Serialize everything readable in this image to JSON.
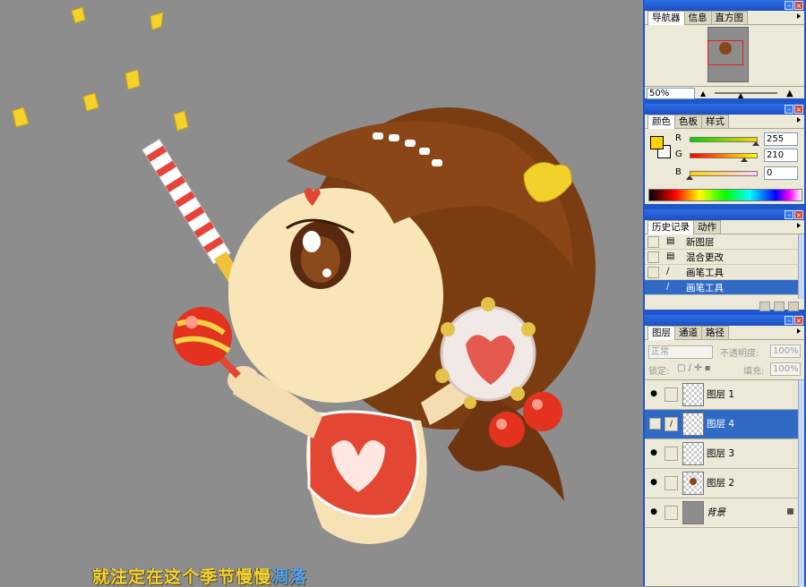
{
  "canvas": {
    "subtitle": "就注定在这个季节慢慢",
    "subtitle_highlight": "凋落",
    "bg_color": "#8d8d8d"
  },
  "navigator_panel": {
    "tabs": [
      "导航器",
      "信息",
      "直方图"
    ],
    "active_tab": 0,
    "zoom_value": "50%"
  },
  "color_panel": {
    "tabs": [
      "颜色",
      "色板",
      "样式"
    ],
    "active_tab": 0,
    "foreground_color": "#ffd200",
    "channels": [
      {
        "label": "R",
        "value": "255",
        "fraction": 1.0
      },
      {
        "label": "G",
        "value": "210",
        "fraction": 0.82
      },
      {
        "label": "B",
        "value": "0",
        "fraction": 0.0
      }
    ]
  },
  "history_panel": {
    "tabs": [
      "历史记录",
      "动作"
    ],
    "active_tab": 0,
    "items": [
      {
        "label": "新图层",
        "icon": "page-icon",
        "selected": false
      },
      {
        "label": "混合更改",
        "icon": "page-icon",
        "selected": false
      },
      {
        "label": "画笔工具",
        "icon": "brush-icon",
        "selected": false
      },
      {
        "label": "画笔工具",
        "icon": "brush-icon",
        "selected": true
      }
    ]
  },
  "layers_panel": {
    "tabs": [
      "图层",
      "通道",
      "路径"
    ],
    "active_tab": 0,
    "blend_mode": "正常",
    "opacity_label": "不透明度:",
    "opacity_value": "100%",
    "lock_label": "锁定:",
    "fill_label": "填充:",
    "fill_value": "100%",
    "layers": [
      {
        "name": "图层 1",
        "visible": true,
        "selected": false
      },
      {
        "name": "图层 4",
        "visible": false,
        "selected": true
      },
      {
        "name": "图层 3",
        "visible": true,
        "selected": false
      },
      {
        "name": "图层 2",
        "visible": true,
        "selected": false
      },
      {
        "name": "背景",
        "visible": true,
        "selected": false,
        "locked": true
      }
    ]
  }
}
